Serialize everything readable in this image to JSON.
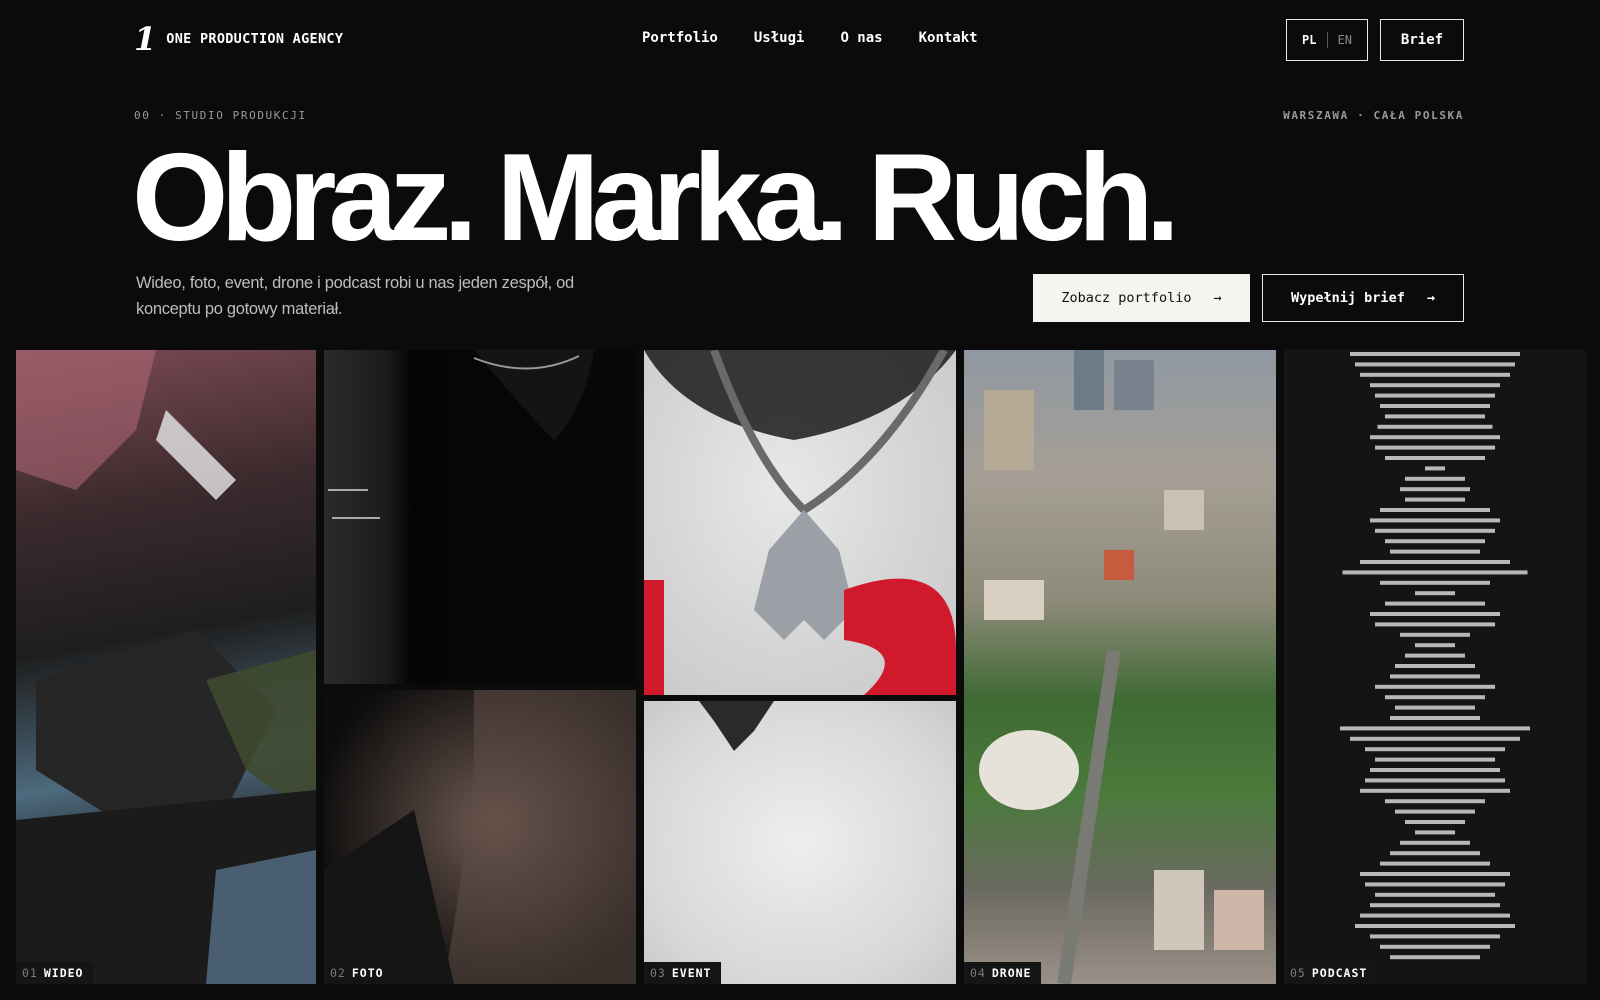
{
  "header": {
    "logo_mark": "1",
    "logo_text": "ONE PRODUCTION AGENCY",
    "nav": [
      "Portfolio",
      "Usługi",
      "O nas",
      "Kontakt"
    ],
    "lang_active": "PL",
    "lang_other": "EN",
    "brief_label": "Brief"
  },
  "hero": {
    "eyebrow_left": "00 · STUDIO PRODUKCJI",
    "eyebrow_right": "WARSZAWA · CAŁA POLSKA",
    "headline": "Obraz. Marka. Ruch.",
    "lead": "Wideo, foto, event, drone i podcast robi u nas jeden zespół, od konceptu po gotowy materiał.",
    "cta_primary": "Zobacz portfolio",
    "cta_secondary": "Wypełnij brief",
    "arrow": "→"
  },
  "tiles": [
    {
      "num": "01",
      "label": "WIDEO"
    },
    {
      "num": "02",
      "label": "FOTO"
    },
    {
      "num": "03",
      "label": "EVENT"
    },
    {
      "num": "04",
      "label": "DRONE"
    },
    {
      "num": "05",
      "label": "PODCAST"
    }
  ],
  "colors": {
    "background": "#0b0b0b",
    "text": "#ffffff",
    "muted": "#9a9a9a",
    "primary_button": "#f4f4f0",
    "waveform": "#b8b8b8"
  },
  "icons": {
    "arrow": "arrow-right-icon"
  }
}
